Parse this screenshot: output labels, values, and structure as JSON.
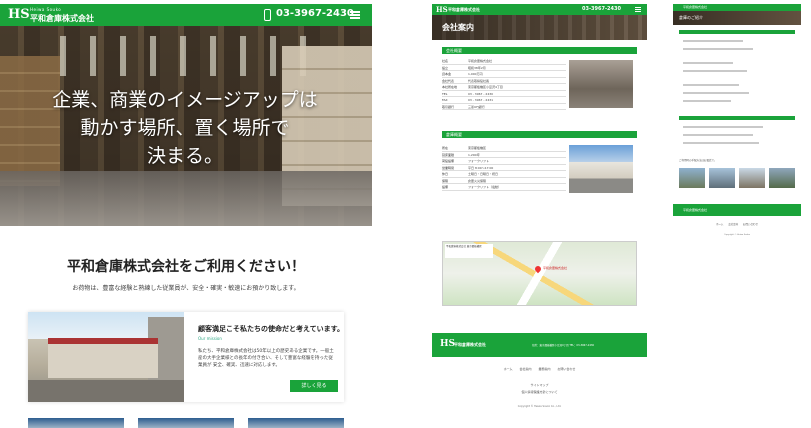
{
  "brand": {
    "mark": "HS",
    "name_en": "Heiwa Souko",
    "name_jp": "平和倉庫株式会社",
    "tel": "03-3967-2430",
    "green": "#1aa33a"
  },
  "home": {
    "hero_lines": [
      "企業、商業のイメージアップは",
      "動かす場所、置く場所で",
      "決まる。"
    ],
    "welcome": "平和倉庫株式会社をご利用ください！",
    "lead": "お荷物は、豊富な経験と熟練した従業員が、安全・確実・敏速にお預かり致します。",
    "card": {
      "title": "顧客満足こそ私たちの使命だと考えています。",
      "sub": "Our mission",
      "text": "私たち、平和倉庫株式会社は50年以上の歴史ある企業です。一般土産の大手企業様との長年の付き合い、そして豊富な経験を持った従業員が 安全、確実、迅速に対応します。",
      "button": "詳しく見る"
    }
  },
  "company": {
    "page_title": "会社案内",
    "section1": "会社概要",
    "section1_rows": [
      {
        "k": "社名",
        "v": "平和倉庫株式会社"
      },
      {
        "k": "設立",
        "v": "昭和38年2月"
      },
      {
        "k": "資本金",
        "v": "1,000万円"
      },
      {
        "k": "会社代表",
        "v": "代表取締役社長"
      },
      {
        "k": "本社所在地",
        "v": "東京都板橋区小豆沢4丁目"
      },
      {
        "k": "TEL",
        "v": "03 - 3967 - 2430"
      },
      {
        "k": "FAX",
        "v": "03 - 3967 - 2431"
      },
      {
        "k": "取引銀行",
        "v": "三菱UFJ銀行"
      }
    ],
    "section2": "倉庫概要",
    "section2_rows": [
      {
        "k": "所在",
        "v": "東京都板橋区"
      },
      {
        "k": "延床面積",
        "v": "1,200坪"
      },
      {
        "k": "荷役設備",
        "v": "フォークリフト"
      },
      {
        "k": "営業時間",
        "v": "平日 8:00〜17:00"
      },
      {
        "k": "休日",
        "v": "土曜日・日曜日・祝日"
      },
      {
        "k": "保険",
        "v": "倉庫火災保険"
      },
      {
        "k": "設備",
        "v": "フォークリフト（電動）"
      }
    ],
    "map_label": "平和倉庫株式会社",
    "map_box": "平和倉庫株式会社 東京都板橋区",
    "footer_addr": "住所：東京都板橋区小豆沢4丁目 TEL：03-3967-2430",
    "footer_links": [
      "ホーム",
      "会社案内",
      "業務案内",
      "お問い合わせ"
    ],
    "sitemap": "サイトマップ",
    "sitemap_sub": "個人情報保護方針について",
    "copyright": "Copyright © Heiwa Souko Co., Ltd."
  },
  "access": {
    "page_title": "倉庫のご紹介",
    "gallery_note": "ご利用時の手配方法はお電話で。",
    "footer_links": [
      "ホーム",
      "会社案内",
      "お問い合わせ"
    ],
    "copyright": "Copyright © Heiwa Souko"
  }
}
